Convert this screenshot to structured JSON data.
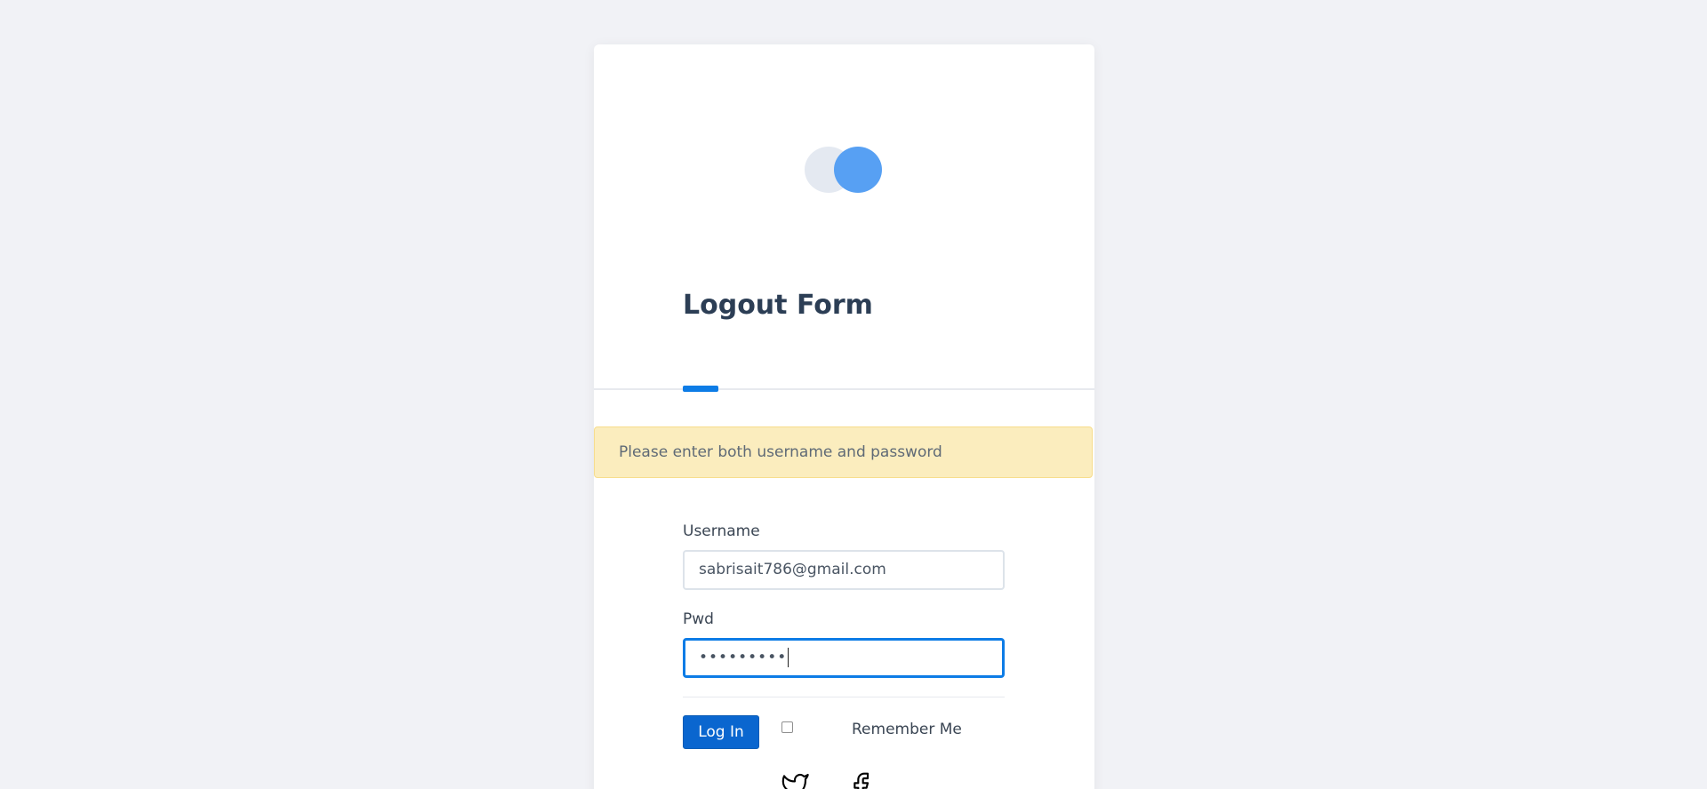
{
  "form": {
    "title": "Logout Form",
    "alert": "Please enter both username and password",
    "username": {
      "label": "Username",
      "value": "sabrisait786@gmail.com"
    },
    "password": {
      "label": "Pwd",
      "value": "•••••••••"
    },
    "login_label": "Log In",
    "remember_label": "Remember Me",
    "remember_checked": false
  },
  "social": [
    "twitter-icon",
    "facebook-icon"
  ],
  "colors": {
    "accent": "#0d7ce6",
    "button": "#0a66cf",
    "alert_bg": "#fbedbe",
    "page_bg": "#f1f2f6"
  }
}
